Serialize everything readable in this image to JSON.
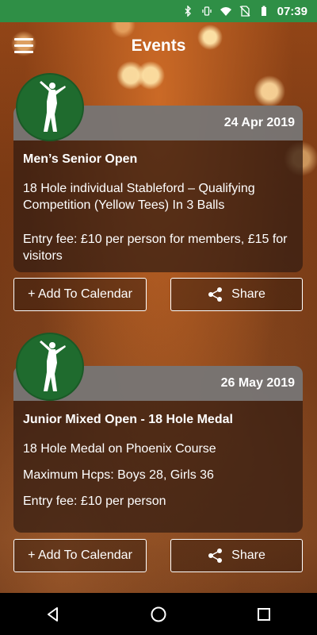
{
  "status_bar": {
    "time": "07:39"
  },
  "app_bar": {
    "title": "Events"
  },
  "events": [
    {
      "date": "24 Apr 2019",
      "title": "Men’s Senior Open",
      "description": "18 Hole individual Stableford – Qualifying Competition (Yellow Tees) In 3 Balls",
      "details": "Entry fee: £10 per person for members, £15 for visitors",
      "calendar_label": "+ Add To Calendar",
      "share_label": "Share"
    },
    {
      "date": "26 May 2019",
      "title": "Junior Mixed Open - 18 Hole Medal",
      "description": "18 Hole Medal on Phoenix Course",
      "details": "Maximum Hcps: Boys 28, Girls 36",
      "fee": "Entry fee: £10 per person",
      "calendar_label": "+ Add To Calendar",
      "share_label": "Share"
    }
  ],
  "colors": {
    "status_bar": "#2f8f46",
    "logo_green": "#1f6b2e",
    "card_header": "#808080"
  },
  "icons": [
    "bluetooth-icon",
    "vibrate-icon",
    "wifi-icon",
    "no-sim-icon",
    "battery-icon",
    "menu-icon",
    "golfer-icon",
    "share-icon",
    "back-icon",
    "home-icon",
    "recents-icon"
  ]
}
